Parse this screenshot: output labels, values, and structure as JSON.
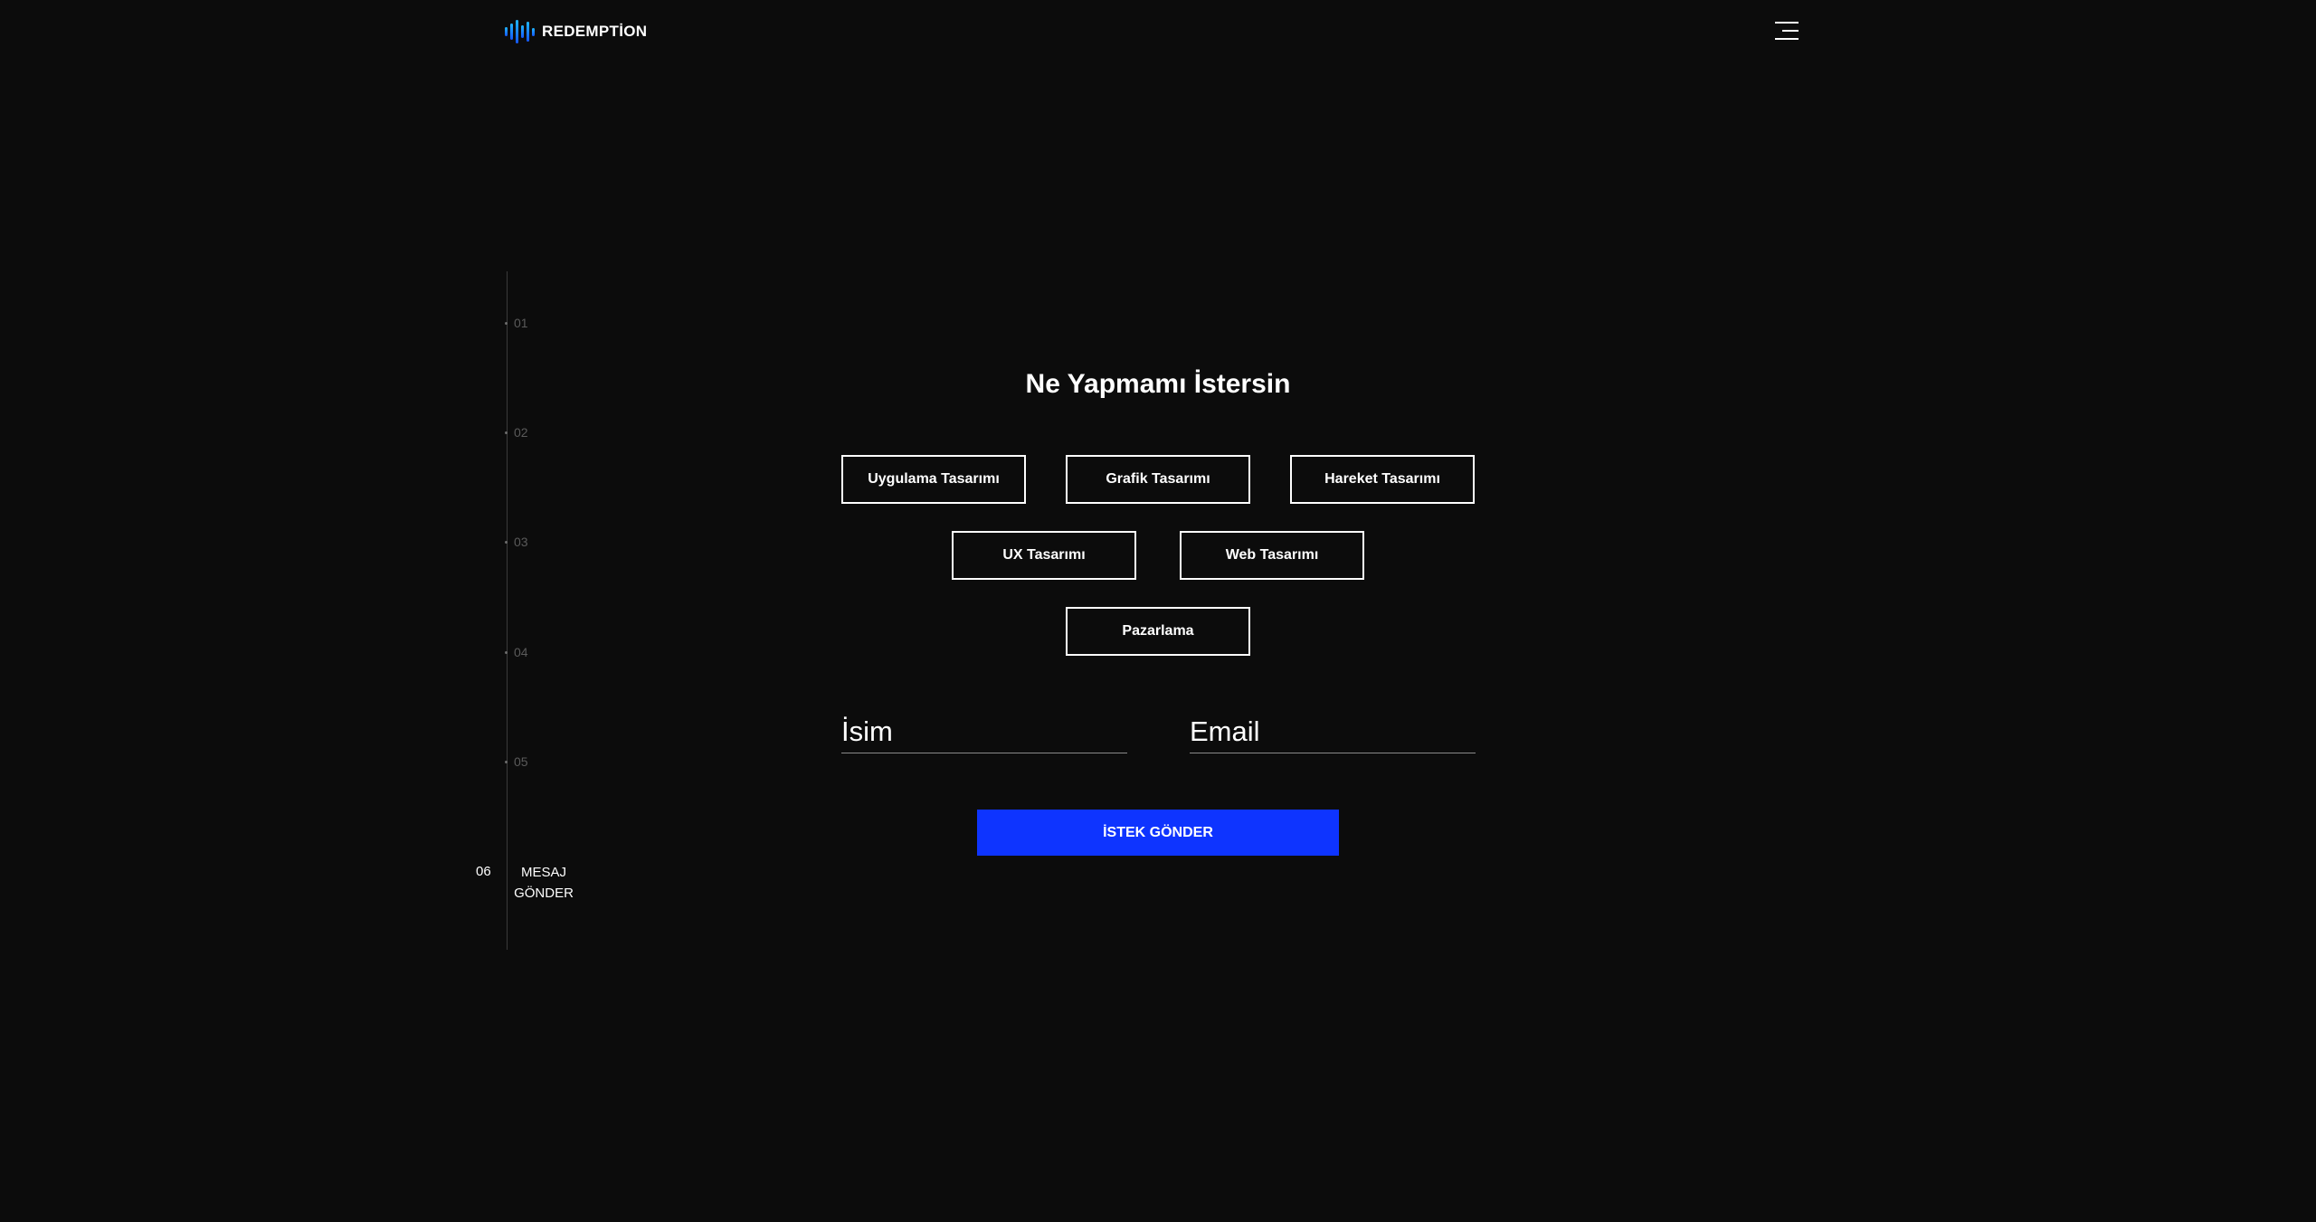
{
  "header": {
    "logo_text": "REDEMPTİON",
    "logo_icon": "sound-wave-icon",
    "menu_icon": "hamburger-menu-icon"
  },
  "steps": {
    "items": [
      "01",
      "02",
      "03",
      "04",
      "05"
    ],
    "active_number": "06",
    "active_label": "MESAJ GÖNDER"
  },
  "form": {
    "title": "Ne Yapmamı İstersin",
    "services": [
      "Uygulama Tasarımı",
      "Grafik Tasarımı",
      "Hareket Tasarımı",
      "UX Tasarımı",
      "Web Tasarımı",
      "Pazarlama"
    ],
    "name_placeholder": "İsim",
    "email_placeholder": "Email",
    "submit_label": "İSTEK GÖNDER"
  },
  "colors": {
    "background": "#0c0c0c",
    "accent": "#0e34ff",
    "logo_gradient": [
      "#1fb6ff",
      "#1457ff"
    ],
    "text": "#ffffff"
  }
}
